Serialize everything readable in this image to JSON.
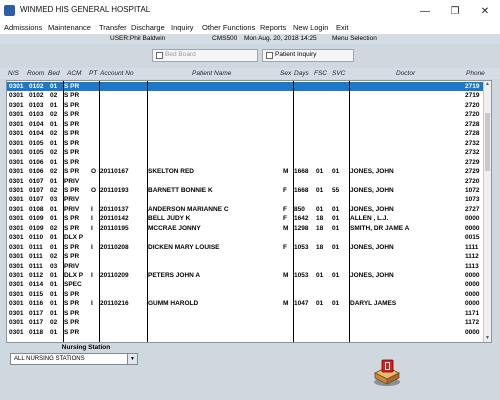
{
  "window": {
    "title": "WINMED HIS GENERAL HOSPITAL",
    "minimize_glyph": "—",
    "maximize_glyph": "❐",
    "close_glyph": "✕"
  },
  "menu": [
    "Admissions",
    "Maintenance",
    "Transfer",
    "Discharge",
    "Inquiry",
    "Other Functions",
    "Reports",
    "New Login",
    "Exit"
  ],
  "userbar": {
    "user": "USER:Phil Baldwin",
    "screen": "CMS500",
    "datetime": "Mon Aug. 20, 2018 14:25",
    "mode": "Menu Selection"
  },
  "board": {
    "bed_board_label": "Bed Board",
    "patient_inquiry_label": "Patient Inquiry"
  },
  "columns": {
    "ns": "N/S",
    "room": "Room",
    "bed": "Bed",
    "acm": "ACM",
    "pt": "PT",
    "account": "Account No",
    "name": "Patient Name",
    "sex": "Sex",
    "days": "Days",
    "fsc": "FSC",
    "svc": "SVC",
    "doctor": "Doctor",
    "phone": "Phone"
  },
  "rows": [
    {
      "ns": "0301",
      "room": "0102",
      "bed": "01",
      "acm": "S PR",
      "pt": "",
      "account": "",
      "name": "",
      "sex": "",
      "days": "",
      "fsc": "",
      "svc": "",
      "doctor": "",
      "phone": "2719",
      "selected": true
    },
    {
      "ns": "0301",
      "room": "0102",
      "bed": "02",
      "acm": "S PR",
      "pt": "",
      "account": "",
      "name": "",
      "sex": "",
      "days": "",
      "fsc": "",
      "svc": "",
      "doctor": "",
      "phone": "2719"
    },
    {
      "ns": "0301",
      "room": "0103",
      "bed": "01",
      "acm": "S PR",
      "pt": "",
      "account": "",
      "name": "",
      "sex": "",
      "days": "",
      "fsc": "",
      "svc": "",
      "doctor": "",
      "phone": "2720"
    },
    {
      "ns": "0301",
      "room": "0103",
      "bed": "02",
      "acm": "S PR",
      "pt": "",
      "account": "",
      "name": "",
      "sex": "",
      "days": "",
      "fsc": "",
      "svc": "",
      "doctor": "",
      "phone": "2720"
    },
    {
      "ns": "0301",
      "room": "0104",
      "bed": "01",
      "acm": "S PR",
      "pt": "",
      "account": "",
      "name": "",
      "sex": "",
      "days": "",
      "fsc": "",
      "svc": "",
      "doctor": "",
      "phone": "2728"
    },
    {
      "ns": "0301",
      "room": "0104",
      "bed": "02",
      "acm": "S PR",
      "pt": "",
      "account": "",
      "name": "",
      "sex": "",
      "days": "",
      "fsc": "",
      "svc": "",
      "doctor": "",
      "phone": "2728"
    },
    {
      "ns": "0301",
      "room": "0105",
      "bed": "01",
      "acm": "S PR",
      "pt": "",
      "account": "",
      "name": "",
      "sex": "",
      "days": "",
      "fsc": "",
      "svc": "",
      "doctor": "",
      "phone": "2732"
    },
    {
      "ns": "0301",
      "room": "0105",
      "bed": "02",
      "acm": "S PR",
      "pt": "",
      "account": "",
      "name": "",
      "sex": "",
      "days": "",
      "fsc": "",
      "svc": "",
      "doctor": "",
      "phone": "2732"
    },
    {
      "ns": "0301",
      "room": "0106",
      "bed": "01",
      "acm": "S PR",
      "pt": "",
      "account": "",
      "name": "",
      "sex": "",
      "days": "",
      "fsc": "",
      "svc": "",
      "doctor": "",
      "phone": "2729"
    },
    {
      "ns": "0301",
      "room": "0106",
      "bed": "02",
      "acm": "S PR",
      "pt": "O",
      "account": "20110167",
      "name": "SKELTON RED",
      "sex": "M",
      "days": "1668",
      "fsc": "01",
      "svc": "01",
      "doctor": "JONES, JOHN",
      "phone": "2729"
    },
    {
      "ns": "0301",
      "room": "0107",
      "bed": "01",
      "acm": "PRIV",
      "pt": "",
      "account": "",
      "name": "",
      "sex": "",
      "days": "",
      "fsc": "",
      "svc": "",
      "doctor": "",
      "phone": "2720"
    },
    {
      "ns": "0301",
      "room": "0107",
      "bed": "02",
      "acm": "S PR",
      "pt": "O",
      "account": "20110193",
      "name": "BARNETT BONNIE K",
      "sex": "F",
      "days": "1668",
      "fsc": "01",
      "svc": "55",
      "doctor": "JONES, JOHN",
      "phone": "1072"
    },
    {
      "ns": "0301",
      "room": "0107",
      "bed": "03",
      "acm": "PRIV",
      "pt": "",
      "account": "",
      "name": "",
      "sex": "",
      "days": "",
      "fsc": "",
      "svc": "",
      "doctor": "",
      "phone": "1073"
    },
    {
      "ns": "0301",
      "room": "0108",
      "bed": "01",
      "acm": "PRIV",
      "pt": "I",
      "account": "20110137",
      "name": "ANDERSON MARIANNE C",
      "sex": "F",
      "days": "850",
      "fsc": "01",
      "svc": "01",
      "doctor": "JONES, JOHN",
      "phone": "2727"
    },
    {
      "ns": "0301",
      "room": "0109",
      "bed": "01",
      "acm": "S PR",
      "pt": "I",
      "account": "20110142",
      "name": "BELL JUDY K",
      "sex": "F",
      "days": "1642",
      "fsc": "18",
      "svc": "01",
      "doctor": "ALLEN , L.J.",
      "phone": "0000"
    },
    {
      "ns": "0301",
      "room": "0109",
      "bed": "02",
      "acm": "S PR",
      "pt": "I",
      "account": "20110195",
      "name": "MCCRAE JONNY",
      "sex": "M",
      "days": "1298",
      "fsc": "18",
      "svc": "01",
      "doctor": "SMITH, DR JAME A",
      "phone": "0000"
    },
    {
      "ns": "0301",
      "room": "0110",
      "bed": "01",
      "acm": "DLX P",
      "pt": "",
      "account": "",
      "name": "",
      "sex": "",
      "days": "",
      "fsc": "",
      "svc": "",
      "doctor": "",
      "phone": "0015"
    },
    {
      "ns": "0301",
      "room": "0111",
      "bed": "01",
      "acm": "S PR",
      "pt": "I",
      "account": "20110208",
      "name": "DICKEN MARY LOUISE",
      "sex": "F",
      "days": "1053",
      "fsc": "18",
      "svc": "01",
      "doctor": "JONES, JOHN",
      "phone": "1111"
    },
    {
      "ns": "0301",
      "room": "0111",
      "bed": "02",
      "acm": "S PR",
      "pt": "",
      "account": "",
      "name": "",
      "sex": "",
      "days": "",
      "fsc": "",
      "svc": "",
      "doctor": "",
      "phone": "1112"
    },
    {
      "ns": "0301",
      "room": "0111",
      "bed": "03",
      "acm": "PRIV",
      "pt": "",
      "account": "",
      "name": "",
      "sex": "",
      "days": "",
      "fsc": "",
      "svc": "",
      "doctor": "",
      "phone": "1113"
    },
    {
      "ns": "0301",
      "room": "0112",
      "bed": "01",
      "acm": "DLX P",
      "pt": "I",
      "account": "20110209",
      "name": "PETERS JOHN A",
      "sex": "M",
      "days": "1053",
      "fsc": "01",
      "svc": "01",
      "doctor": "JONES, JOHN",
      "phone": "0000"
    },
    {
      "ns": "0301",
      "room": "0114",
      "bed": "01",
      "acm": "SPEC",
      "pt": "",
      "account": "",
      "name": "",
      "sex": "",
      "days": "",
      "fsc": "",
      "svc": "",
      "doctor": "",
      "phone": "0000"
    },
    {
      "ns": "0301",
      "room": "0115",
      "bed": "01",
      "acm": "S PR",
      "pt": "",
      "account": "",
      "name": "",
      "sex": "",
      "days": "",
      "fsc": "",
      "svc": "",
      "doctor": "",
      "phone": "0000"
    },
    {
      "ns": "0301",
      "room": "0116",
      "bed": "01",
      "acm": "S PR",
      "pt": "I",
      "account": "20110216",
      "name": "GUMM HAROLD",
      "sex": "M",
      "days": "1047",
      "fsc": "01",
      "svc": "01",
      "doctor": "DARYL JAMES",
      "phone": "0000"
    },
    {
      "ns": "0301",
      "room": "0117",
      "bed": "01",
      "acm": "S PR",
      "pt": "",
      "account": "",
      "name": "",
      "sex": "",
      "days": "",
      "fsc": "",
      "svc": "",
      "doctor": "",
      "phone": "1171"
    },
    {
      "ns": "0301",
      "room": "0117",
      "bed": "02",
      "acm": "S PR",
      "pt": "",
      "account": "",
      "name": "",
      "sex": "",
      "days": "",
      "fsc": "",
      "svc": "",
      "doctor": "",
      "phone": "1172"
    },
    {
      "ns": "0301",
      "room": "0118",
      "bed": "01",
      "acm": "S PR",
      "pt": "",
      "account": "",
      "name": "",
      "sex": "",
      "days": "",
      "fsc": "",
      "svc": "",
      "doctor": "",
      "phone": "0000"
    }
  ],
  "nursing_station": {
    "label": "Nursing Station",
    "value": "ALL NURSING STATIONS",
    "arrow_glyph": "▼"
  },
  "exit_icon": "exit-door-icon",
  "colors": {
    "selection": "#1e78c8",
    "background": "#cfd7df",
    "header_band": "#d5dde4"
  }
}
